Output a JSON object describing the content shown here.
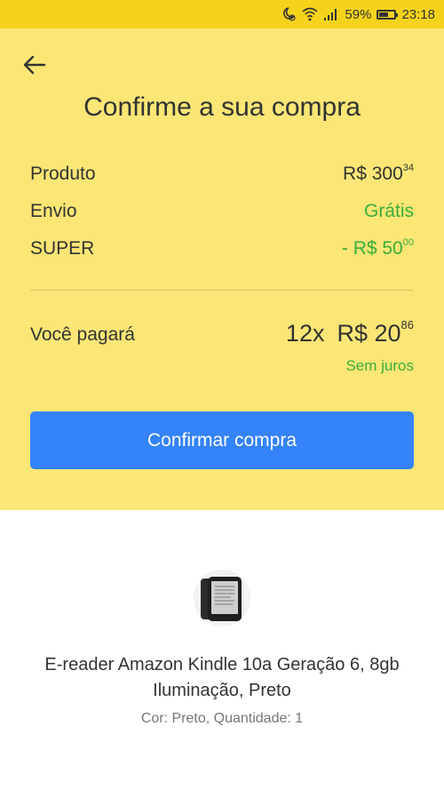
{
  "status_bar": {
    "battery_percent": "59%",
    "battery_level": 0.59,
    "time": "23:18",
    "icons": [
      "moon-alarm-icon",
      "wifi-icon",
      "signal-icon",
      "battery-icon"
    ]
  },
  "header": {
    "back_icon": "arrow-left-icon",
    "title": "Confirme a sua compra"
  },
  "summary": {
    "rows": [
      {
        "label": "Produto",
        "value_main": "R$ 300",
        "value_cents": "34",
        "color": "#333333"
      },
      {
        "label": "Envio",
        "value_main": "Grátis",
        "value_cents": "",
        "color": "#3aad3a"
      },
      {
        "label": "SUPER",
        "value_main": "- R$ 50",
        "value_cents": "00",
        "color": "#3aad3a"
      }
    ],
    "total": {
      "label": "Você pagará",
      "installments": "12x",
      "amount_main": "R$ 20",
      "amount_cents": "86",
      "note": "Sem juros"
    }
  },
  "confirm_button": {
    "label": "Confirmar compra",
    "color": "#3483fa"
  },
  "product": {
    "image_icon": "e-reader-icon",
    "title": "E-reader Amazon Kindle 10a Geração 6, 8gb Iluminação, Preto",
    "meta": "Cor: Preto, Quantidade: 1"
  },
  "colors": {
    "status_bar": "#f5d31b",
    "panel": "#fbe676",
    "green": "#3aad3a"
  }
}
